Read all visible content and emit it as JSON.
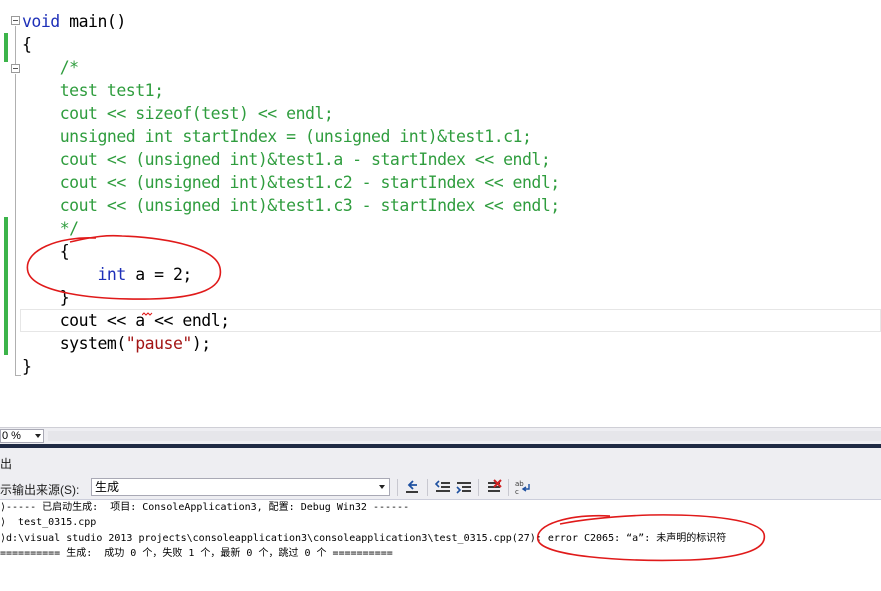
{
  "editor": {
    "lines": [
      {
        "kw": "void",
        "rest": " main()"
      },
      {
        "text": "{"
      },
      {
        "comment": "    /*"
      },
      {
        "comment": "    test test1;"
      },
      {
        "comment": "    cout << sizeof(test) << endl;"
      },
      {
        "comment": "    unsigned int startIndex = (unsigned int)&test1.c1;"
      },
      {
        "comment": "    cout << (unsigned int)&test1.a - startIndex << endl;"
      },
      {
        "comment": "    cout << (unsigned int)&test1.c2 - startIndex << endl;"
      },
      {
        "comment": "    cout << (unsigned int)&test1.c3 - startIndex << endl;"
      },
      {
        "comment": "    */"
      },
      {
        "text": "    {"
      },
      {
        "pre": "        ",
        "kw": "int",
        "rest": " a = 2;"
      },
      {
        "text": "    }"
      },
      {
        "pre": "    cout << ",
        "err": "a",
        "rest": " << endl;"
      },
      {
        "pre": "    system(",
        "str": "\"pause\"",
        "rest": ");"
      },
      {
        "text": "}"
      }
    ]
  },
  "status": {
    "zoom": "0 %"
  },
  "output": {
    "title": "出",
    "show_label": "示输出来源(S):",
    "source_value": "生成",
    "toolbar_icons": [
      "goto-prev-message-icon",
      "find-prev-icon",
      "find-next-icon",
      "clear-all-icon",
      "toggle-word-wrap-icon"
    ],
    "lines": [
      "⟩----- 已启动生成:  项目: ConsoleApplication3, 配置: Debug Win32 ------",
      "⟩  test_0315.cpp",
      "⟩d:\\visual studio 2013 projects\\consoleapplication3\\consoleapplication3\\test_0315.cpp(27): error C2065: “a”: 未声明的标识符",
      "========== 生成:  成功 0 个，失败 1 个，最新 0 个，跳过 0 个 =========="
    ]
  },
  "colors": {
    "keyword": "#1d2fb8",
    "comment": "#2f9d3e",
    "string": "#a31515",
    "change_bar": "#3cb44a",
    "annotation": "#e01a1a"
  }
}
